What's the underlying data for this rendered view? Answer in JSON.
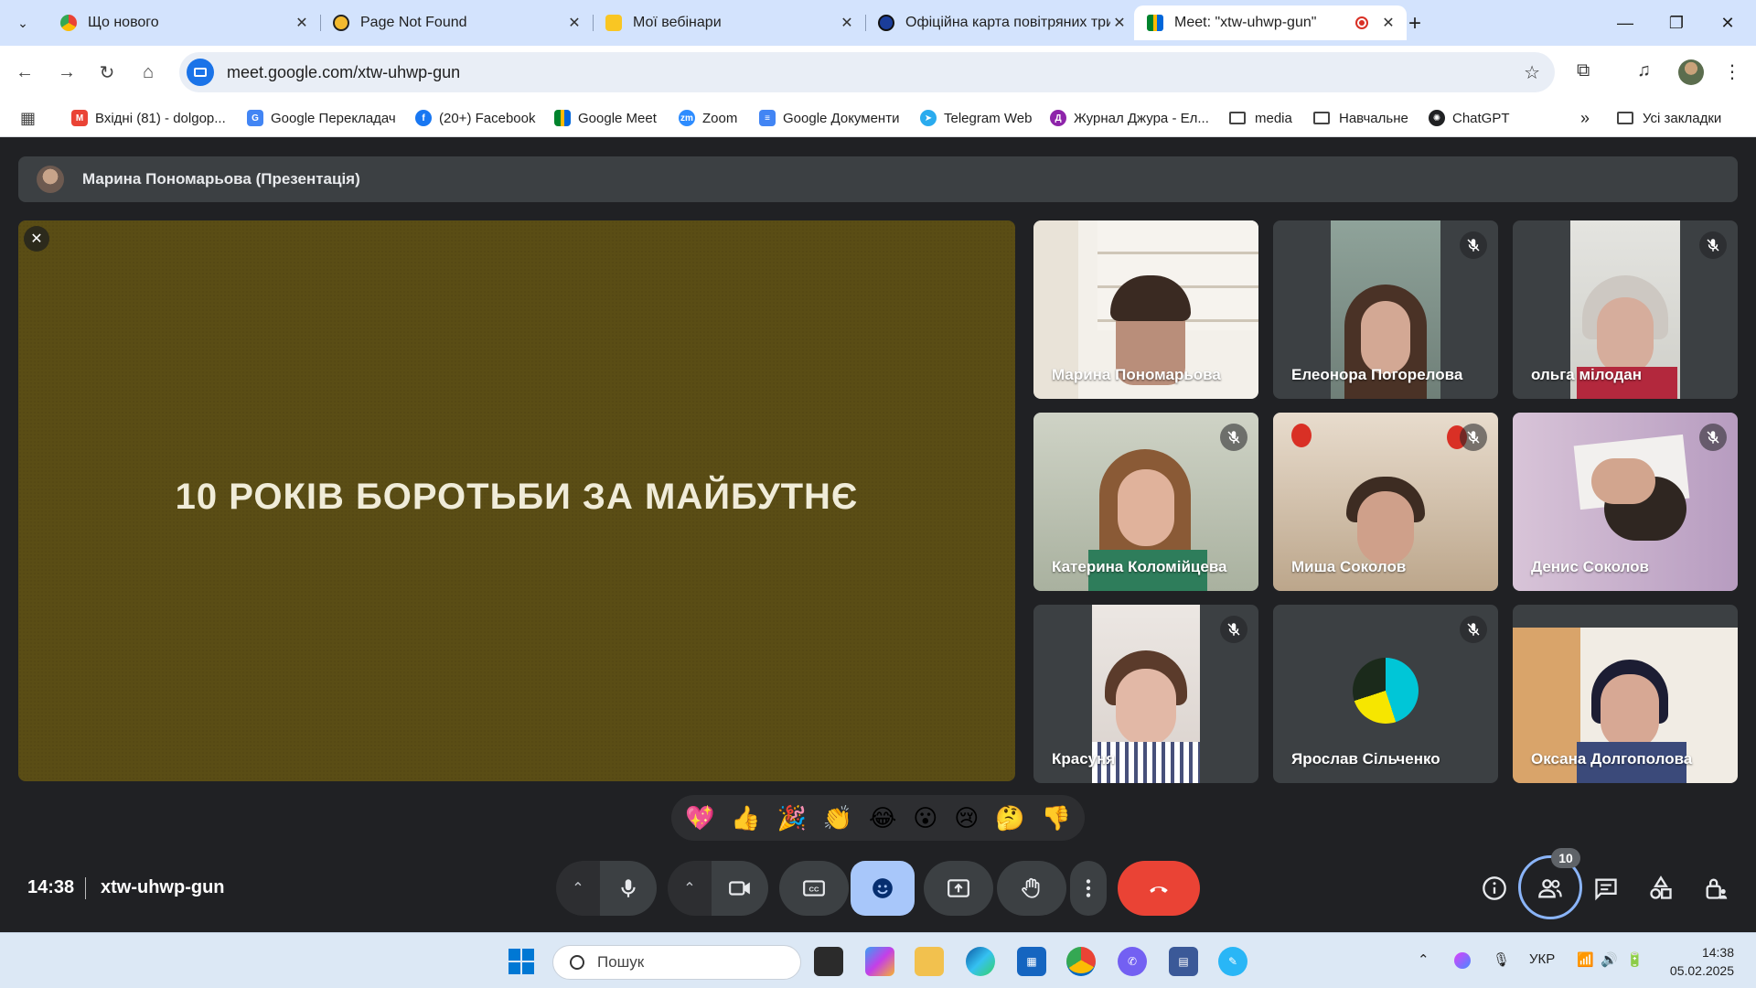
{
  "tabs": [
    {
      "title": "Що нового",
      "icon": "chrome-icon"
    },
    {
      "title": "Page Not Found",
      "icon": "coin-icon"
    },
    {
      "title": "Мої вебінари",
      "icon": "bell-icon"
    },
    {
      "title": "Офіційна карта повітряних три",
      "icon": "map-icon"
    },
    {
      "title": "Meet: \"xtw-uhwp-gun\"",
      "icon": "meet-icon",
      "active": true,
      "recording": true
    }
  ],
  "toolbar": {
    "url": "meet.google.com/xtw-uhwp-gun"
  },
  "bookmarks": [
    {
      "label": "Вхідні (81) - dolgop...",
      "icon": "gmail-icon",
      "color": "#ea4335"
    },
    {
      "label": "Google Перекладач",
      "icon": "translate-icon",
      "color": "#4285f4"
    },
    {
      "label": "(20+) Facebook",
      "icon": "facebook-icon",
      "color": "#1877f2"
    },
    {
      "label": "Google Meet",
      "icon": "meet-icon",
      "color": "#00897b"
    },
    {
      "label": "Zoom",
      "icon": "zoom-icon",
      "color": "#2d8cff"
    },
    {
      "label": "Google Документи",
      "icon": "docs-icon",
      "color": "#4285f4"
    },
    {
      "label": "Telegram Web",
      "icon": "telegram-icon",
      "color": "#2aabee"
    },
    {
      "label": "Журнал Джура - Ел...",
      "icon": "journal-icon",
      "color": "#8e24aa"
    },
    {
      "label": "media",
      "icon": "folder-icon"
    },
    {
      "label": "Навчальне",
      "icon": "folder-icon"
    },
    {
      "label": "ChatGPT",
      "icon": "chatgpt-icon",
      "color": "#202123"
    }
  ],
  "all_bookmarks": "Усі закладки",
  "presenter": {
    "label": "Марина Пономарьова (Презентація)"
  },
  "slide": {
    "title": "10 РОКІВ БОРОТЬБИ ЗА МАЙБУТНЄ"
  },
  "participants": [
    {
      "name": "Марина Пономарьова",
      "muted": false
    },
    {
      "name": "Елеонора Погорелова",
      "muted": true
    },
    {
      "name": "ольга мілодан",
      "muted": true
    },
    {
      "name": "Катерина Коломійцева",
      "muted": true
    },
    {
      "name": "Миша Соколов",
      "muted": true
    },
    {
      "name": "Денис Соколов",
      "muted": true
    },
    {
      "name": "Красуня",
      "muted": true
    },
    {
      "name": "Ярослав Сільченко",
      "muted": true
    },
    {
      "name": "Оксана Долгополова",
      "muted": false
    }
  ],
  "reactions": [
    "💖",
    "👍",
    "🎉",
    "👏",
    "😂",
    "😮",
    "😢",
    "🤔",
    "👎"
  ],
  "meeting": {
    "time": "14:38",
    "code": "xtw-uhwp-gun",
    "people_count": "10"
  },
  "taskbar": {
    "search_placeholder": "Пошук",
    "language": "УКР",
    "time": "14:38",
    "date": "05.02.2025"
  },
  "colors": {
    "meet_bg": "#202124",
    "slide_bg": "#5a4d15",
    "end_call": "#ea4335",
    "active_control": "#a8c7fa",
    "tab_strip": "#d3e3fd"
  }
}
